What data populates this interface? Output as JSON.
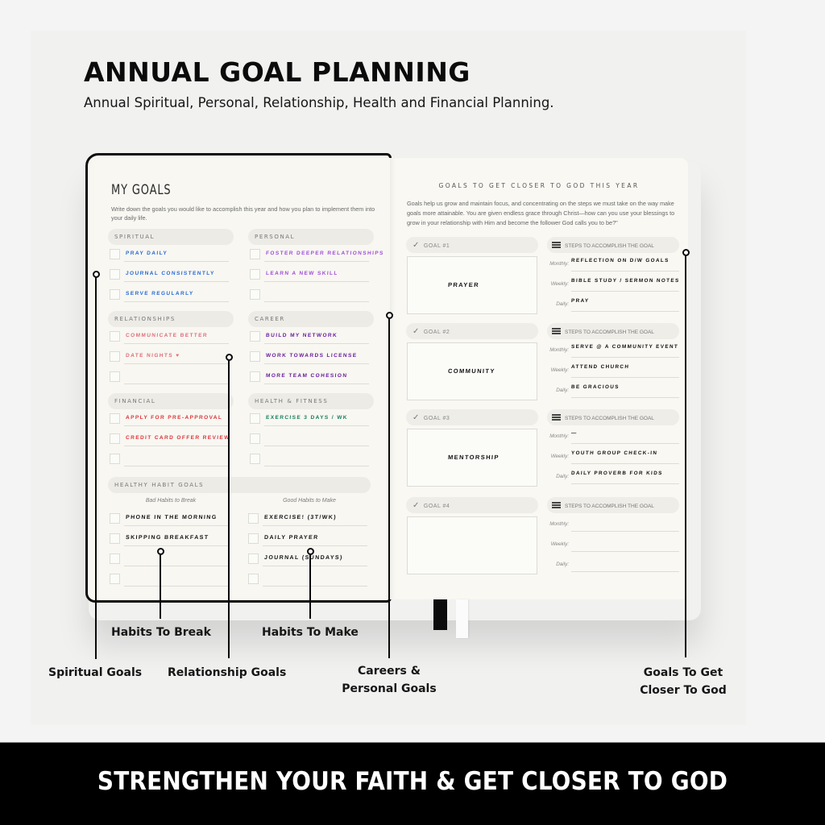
{
  "header": {
    "title": "ANNUAL GOAL PLANNING",
    "subtitle": "Annual Spiritual, Personal, Relationship, Health and Financial Planning."
  },
  "left_page": {
    "title": "MY GOALS",
    "intro": "Write down the goals you would like to accomplish this year and how you plan to implement them into your daily life.",
    "sections": [
      {
        "name": "SPIRITUAL",
        "ink": "#2a6bd6",
        "entries": [
          "PRAY DAILY",
          "JOURNAL CONSISTENTLY",
          "SERVE REGULARLY"
        ]
      },
      {
        "name": "PERSONAL",
        "ink": "#a24fd8",
        "entries": [
          "FOSTER DEEPER RELATIONSHIPS",
          "LEARN A NEW SKILL",
          ""
        ]
      },
      {
        "name": "RELATIONSHIPS",
        "ink": "#e0707a",
        "entries": [
          "COMMUNICATE BETTER",
          "DATE NIGHTS ♥",
          ""
        ]
      },
      {
        "name": "CAREER",
        "ink": "#6a1fa0",
        "entries": [
          "BUILD MY NETWORK",
          "WORK TOWARDS LICENSE",
          "MORE TEAM COHESION"
        ]
      },
      {
        "name": "FINANCIAL",
        "ink": "#e0353a",
        "entries": [
          "APPLY FOR PRE-APPROVAL",
          "CREDIT CARD OFFER REVIEW",
          ""
        ]
      },
      {
        "name": "HEALTH & FITNESS",
        "ink": "#17805f",
        "entries": [
          "EXERCISE 3 DAYS / WK",
          "",
          ""
        ]
      }
    ],
    "habits": {
      "title": "HEALTHY HABIT GOALS",
      "bad_label": "Bad Habits to Break",
      "good_label": "Good Habits to Make",
      "bad": [
        "PHONE IN THE MORNING",
        "SKIPPING BREAKFAST",
        "",
        ""
      ],
      "good": [
        "EXERCISE! (3T/WK)",
        "DAILY PRAYER",
        "JOURNAL (SUNDAYS)",
        ""
      ]
    }
  },
  "right_page": {
    "title": "GOALS TO GET CLOSER TO GOD THIS YEAR",
    "intro": "Goals help us grow and maintain focus, and concentrating on the steps we must take on the way make goals more attainable. You are given endless grace through Christ—how can you use your blessings to grow in your relationship with Him and become the follower God calls you to be?\"",
    "steps_label": "STEPS TO ACCOMPLISH THE GOAL",
    "step_labels": {
      "monthly": "Monthly:",
      "weekly": "Weekly:",
      "daily": "Daily:"
    },
    "goals": [
      {
        "label": "GOAL #1",
        "goal": "PRAYER",
        "monthly": "REFLECTION ON D/W GOALS",
        "weekly": "BIBLE STUDY / SERMON NOTES",
        "daily": "PRAY"
      },
      {
        "label": "GOAL #2",
        "goal": "COMMUNITY",
        "monthly": "SERVE @ A COMMUNITY EVENT",
        "weekly": "ATTEND CHURCH",
        "daily": "BE GRACIOUS"
      },
      {
        "label": "GOAL #3",
        "goal": "MENTORSHIP",
        "monthly": "—",
        "weekly": "YOUTH GROUP CHECK-IN",
        "daily": "DAILY PROVERB FOR KIDS"
      },
      {
        "label": "GOAL #4",
        "goal": "",
        "monthly": "",
        "weekly": "",
        "daily": ""
      }
    ]
  },
  "callouts": {
    "spiritual": "Spiritual Goals",
    "habits_break": "Habits To Break",
    "relationship": "Relationship Goals",
    "habits_make": "Habits To Make",
    "careers_line1": "Careers &",
    "careers_line2": "Personal Goals",
    "closer_line1": "Goals To Get",
    "closer_line2": "Closer To God"
  },
  "banner": {
    "text": "STRENGTHEN YOUR FAITH & GET CLOSER TO GOD"
  }
}
